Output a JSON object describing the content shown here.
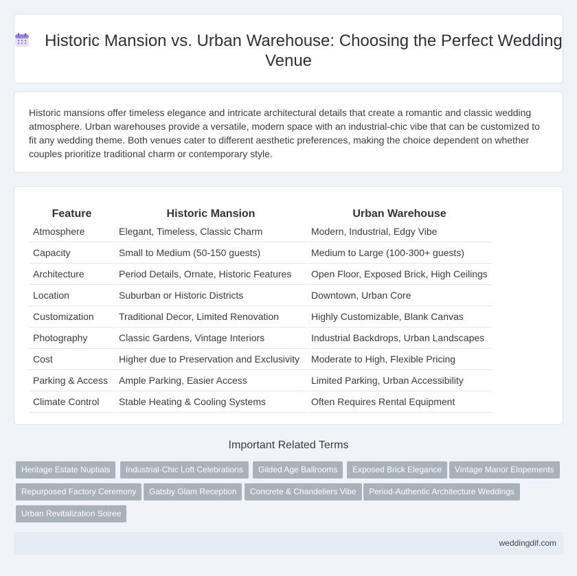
{
  "header": {
    "title": "Historic Mansion vs. Urban Warehouse: Choosing the Perfect Wedding Venue",
    "icon": "calendar-icon"
  },
  "intro": {
    "text": "Historic mansions offer timeless elegance and intricate architectural details that create a romantic and classic wedding atmosphere. Urban warehouses provide a versatile, modern space with an industrial-chic vibe that can be customized to fit any wedding theme. Both venues cater to different aesthetic preferences, making the choice dependent on whether couples prioritize traditional charm or contemporary style."
  },
  "table": {
    "headers": [
      "Feature",
      "Historic Mansion",
      "Urban Warehouse"
    ],
    "rows": [
      [
        "Atmosphere",
        "Elegant, Timeless, Classic Charm",
        "Modern, Industrial, Edgy Vibe"
      ],
      [
        "Capacity",
        "Small to Medium (50-150 guests)",
        "Medium to Large (100-300+ guests)"
      ],
      [
        "Architecture",
        "Period Details, Ornate, Historic Features",
        "Open Floor, Exposed Brick, High Ceilings"
      ],
      [
        "Location",
        "Suburban or Historic Districts",
        "Downtown, Urban Core"
      ],
      [
        "Customization",
        "Traditional Decor, Limited Renovation",
        "Highly Customizable, Blank Canvas"
      ],
      [
        "Photography",
        "Classic Gardens, Vintage Interiors",
        "Industrial Backdrops, Urban Landscapes"
      ],
      [
        "Cost",
        "Higher due to Preservation and Exclusivity",
        "Moderate to High, Flexible Pricing"
      ],
      [
        "Parking & Access",
        "Ample Parking, Easier Access",
        "Limited Parking, Urban Accessibility"
      ],
      [
        "Climate Control",
        "Stable Heating & Cooling Systems",
        "Often Requires Rental Equipment"
      ]
    ]
  },
  "related": {
    "title": "Important Related Terms",
    "tags": [
      "Heritage Estate Nuptials",
      "Industrial-Chic Loft Celebrations",
      "Gilded Age Ballrooms",
      "Exposed Brick Elegance",
      "Vintage Manor Elopements",
      "Repurposed Factory Ceremony",
      "Gatsby Glam Reception",
      "Concrete & Chandeliers Vibe",
      "Period-Authentic Architecture Weddings",
      "Urban Revitalization Soiree"
    ]
  },
  "footer": {
    "site": "weddingdif.com"
  },
  "colors": {
    "background": "#f0f3f8",
    "tag": "#a9b1bb",
    "footer": "#e6ecf5"
  }
}
